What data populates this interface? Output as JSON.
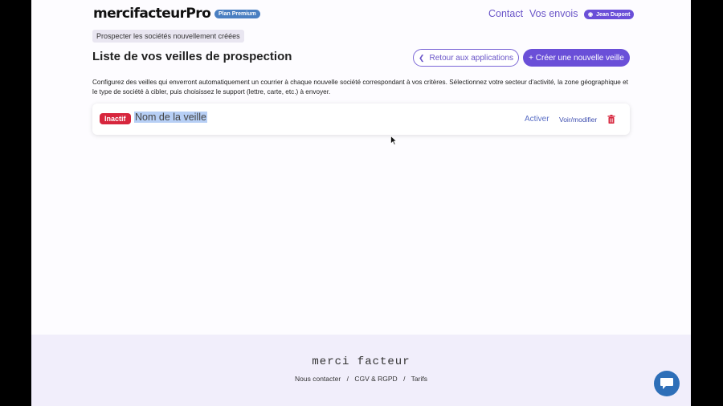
{
  "header": {
    "logo": "mercifacteurPro",
    "plan_badge": "Plan Premium",
    "nav": {
      "contact": "Contact",
      "envois": "Vos envois"
    },
    "user": "Jean Dupont"
  },
  "breadcrumb": "Prospecter les sociétés nouvellement créées",
  "page_title": "Liste de vos veilles de prospection",
  "buttons": {
    "back": "Retour aux applications",
    "new": "+ Créer une nouvelle veille"
  },
  "description": "Configurez des veilles qui enverront automatiquement un courrier à chaque nouvelle société correspondant à vos critères. Sélectionnez votre secteur d'activité, la zone géographique et le type de société à cibler, puis choisissez le support (lettre, carte, etc.) à envoyer.",
  "watches": [
    {
      "status": "Inactif",
      "name": "Nom de la veille",
      "activate": "Activer",
      "edit": "Voir/modifier"
    }
  ],
  "footer": {
    "logo": "merci facteur",
    "links": [
      "Nous contacter",
      "CGV & RGPD",
      "Tarifs"
    ],
    "separator": "/"
  },
  "colors": {
    "accent": "#6a4fd8",
    "inactive_badge": "#d7263d",
    "plan_badge": "#4a7fc1",
    "chat": "#2e6fb8"
  },
  "icons": [
    "chevron-left-icon",
    "user-icon",
    "trash-icon",
    "chat-icon",
    "mouse-cursor-icon"
  ]
}
